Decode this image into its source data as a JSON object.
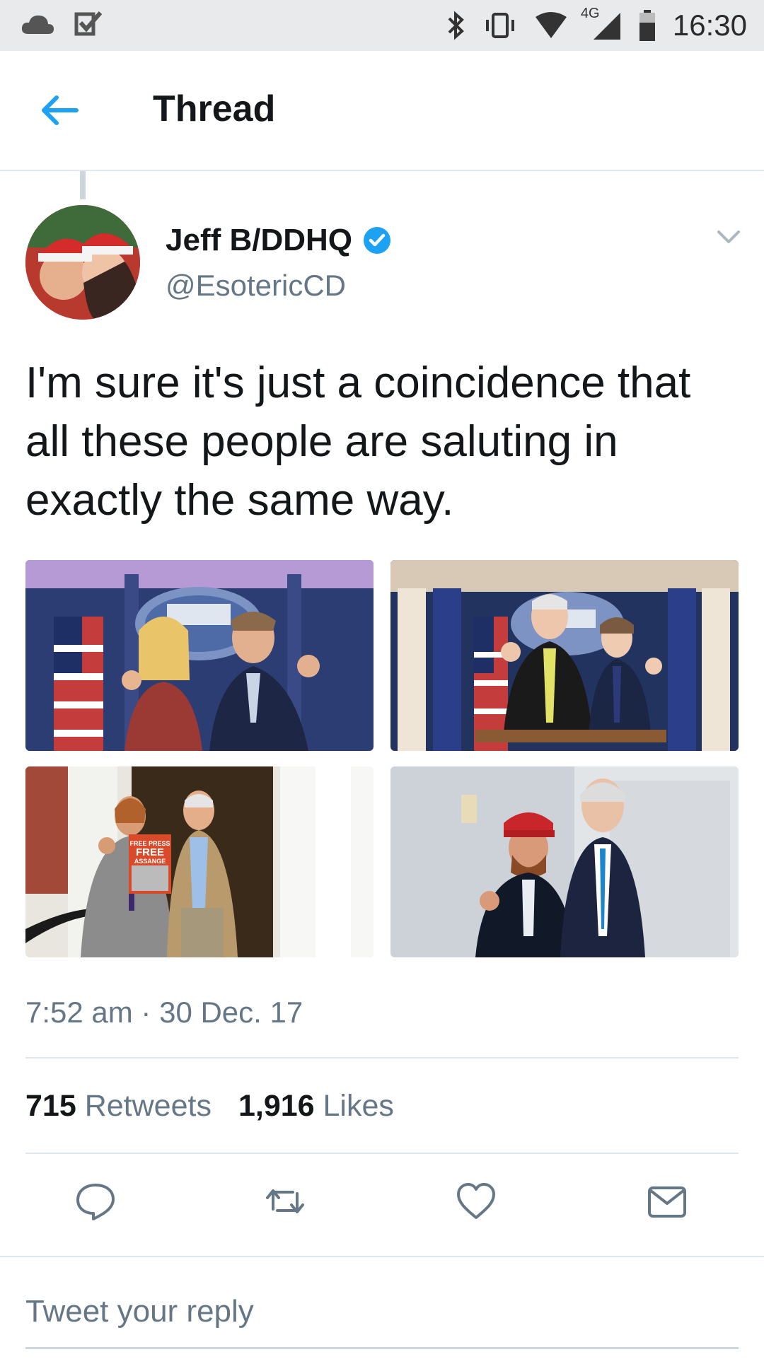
{
  "status_bar": {
    "time": "16:30",
    "network": "4G",
    "icons_left": [
      "cloud-icon",
      "checkbox-icon"
    ],
    "icons_right": [
      "bluetooth-icon",
      "vibrate-icon",
      "wifi-icon",
      "signal-icon",
      "battery-icon"
    ]
  },
  "header": {
    "title": "Thread",
    "back_icon": "arrow-left-icon",
    "accent": "#1da1f2"
  },
  "tweet": {
    "author_name": "Jeff B/DDHQ",
    "verified": true,
    "handle": "@EsotericCD",
    "text": "I'm sure it's just a coincidence that all these people are saluting in exactly the same way.",
    "media": [
      {
        "name": "photo-1"
      },
      {
        "name": "photo-2"
      },
      {
        "name": "photo-3",
        "sign_lines": [
          "FREE PRESS",
          "FREE",
          "ASSANGE"
        ]
      },
      {
        "name": "photo-4"
      }
    ],
    "timestamp": "7:52 am · 30 Dec. 17",
    "retweets_count": "715",
    "retweets_label": "Retweets",
    "likes_count": "1,916",
    "likes_label": "Likes"
  },
  "actions": [
    "reply-icon",
    "retweet-icon",
    "like-icon",
    "message-icon"
  ],
  "reply": {
    "placeholder": "Tweet your reply"
  }
}
